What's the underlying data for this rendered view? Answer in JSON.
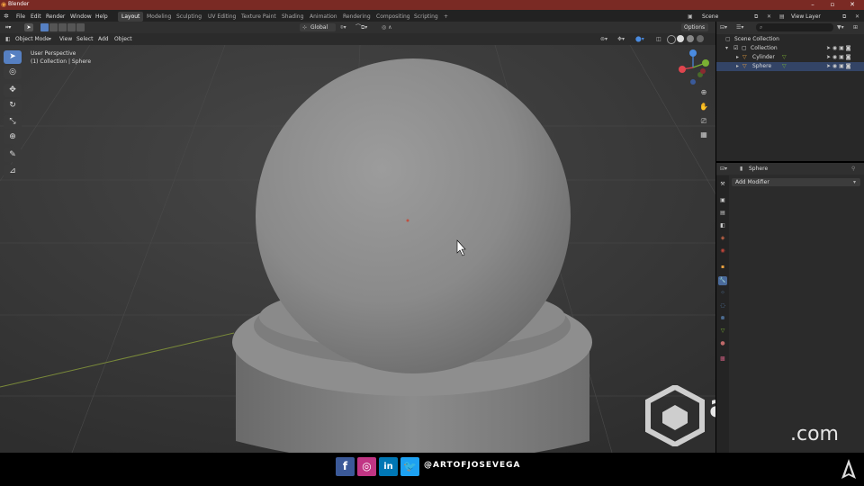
{
  "window": {
    "title": "Blender"
  },
  "menu": [
    "File",
    "Edit",
    "Render",
    "Window",
    "Help"
  ],
  "workspaces": [
    "Layout",
    "Modeling",
    "Sculpting",
    "UV Editing",
    "Texture Paint",
    "Shading",
    "Animation",
    "Rendering",
    "Compositing",
    "Scripting"
  ],
  "workspace_add": "+",
  "scene": {
    "label": "Scene",
    "view_layer": "View Layer"
  },
  "viewport": {
    "mode": "Object Mode",
    "menus": [
      "View",
      "Select",
      "Add",
      "Object"
    ],
    "transform_orientation": "Global",
    "options": "Options",
    "overlay_title": "User Perspective",
    "overlay_sub": "(1) Collection | Sphere",
    "gizmo_axes": {
      "x": "X",
      "y": "Y",
      "z": "Z"
    }
  },
  "outliner": {
    "scene_collection": "Scene Collection",
    "collection": "Collection",
    "objects": [
      "Cylinder",
      "Sphere"
    ]
  },
  "properties": {
    "object_name": "Sphere",
    "add_modifier": "Add Modifier"
  },
  "watermark": {
    "brand": "aeziyuan",
    "domain": ".com"
  },
  "footer": {
    "handle": "@ARTOFJOSEVEGA"
  },
  "colors": {
    "accent": "#5680c2",
    "titlebar": "#7a2a24",
    "x_axis": "#e0454e",
    "y_axis": "#7ab033",
    "z_axis": "#4a8be0"
  }
}
